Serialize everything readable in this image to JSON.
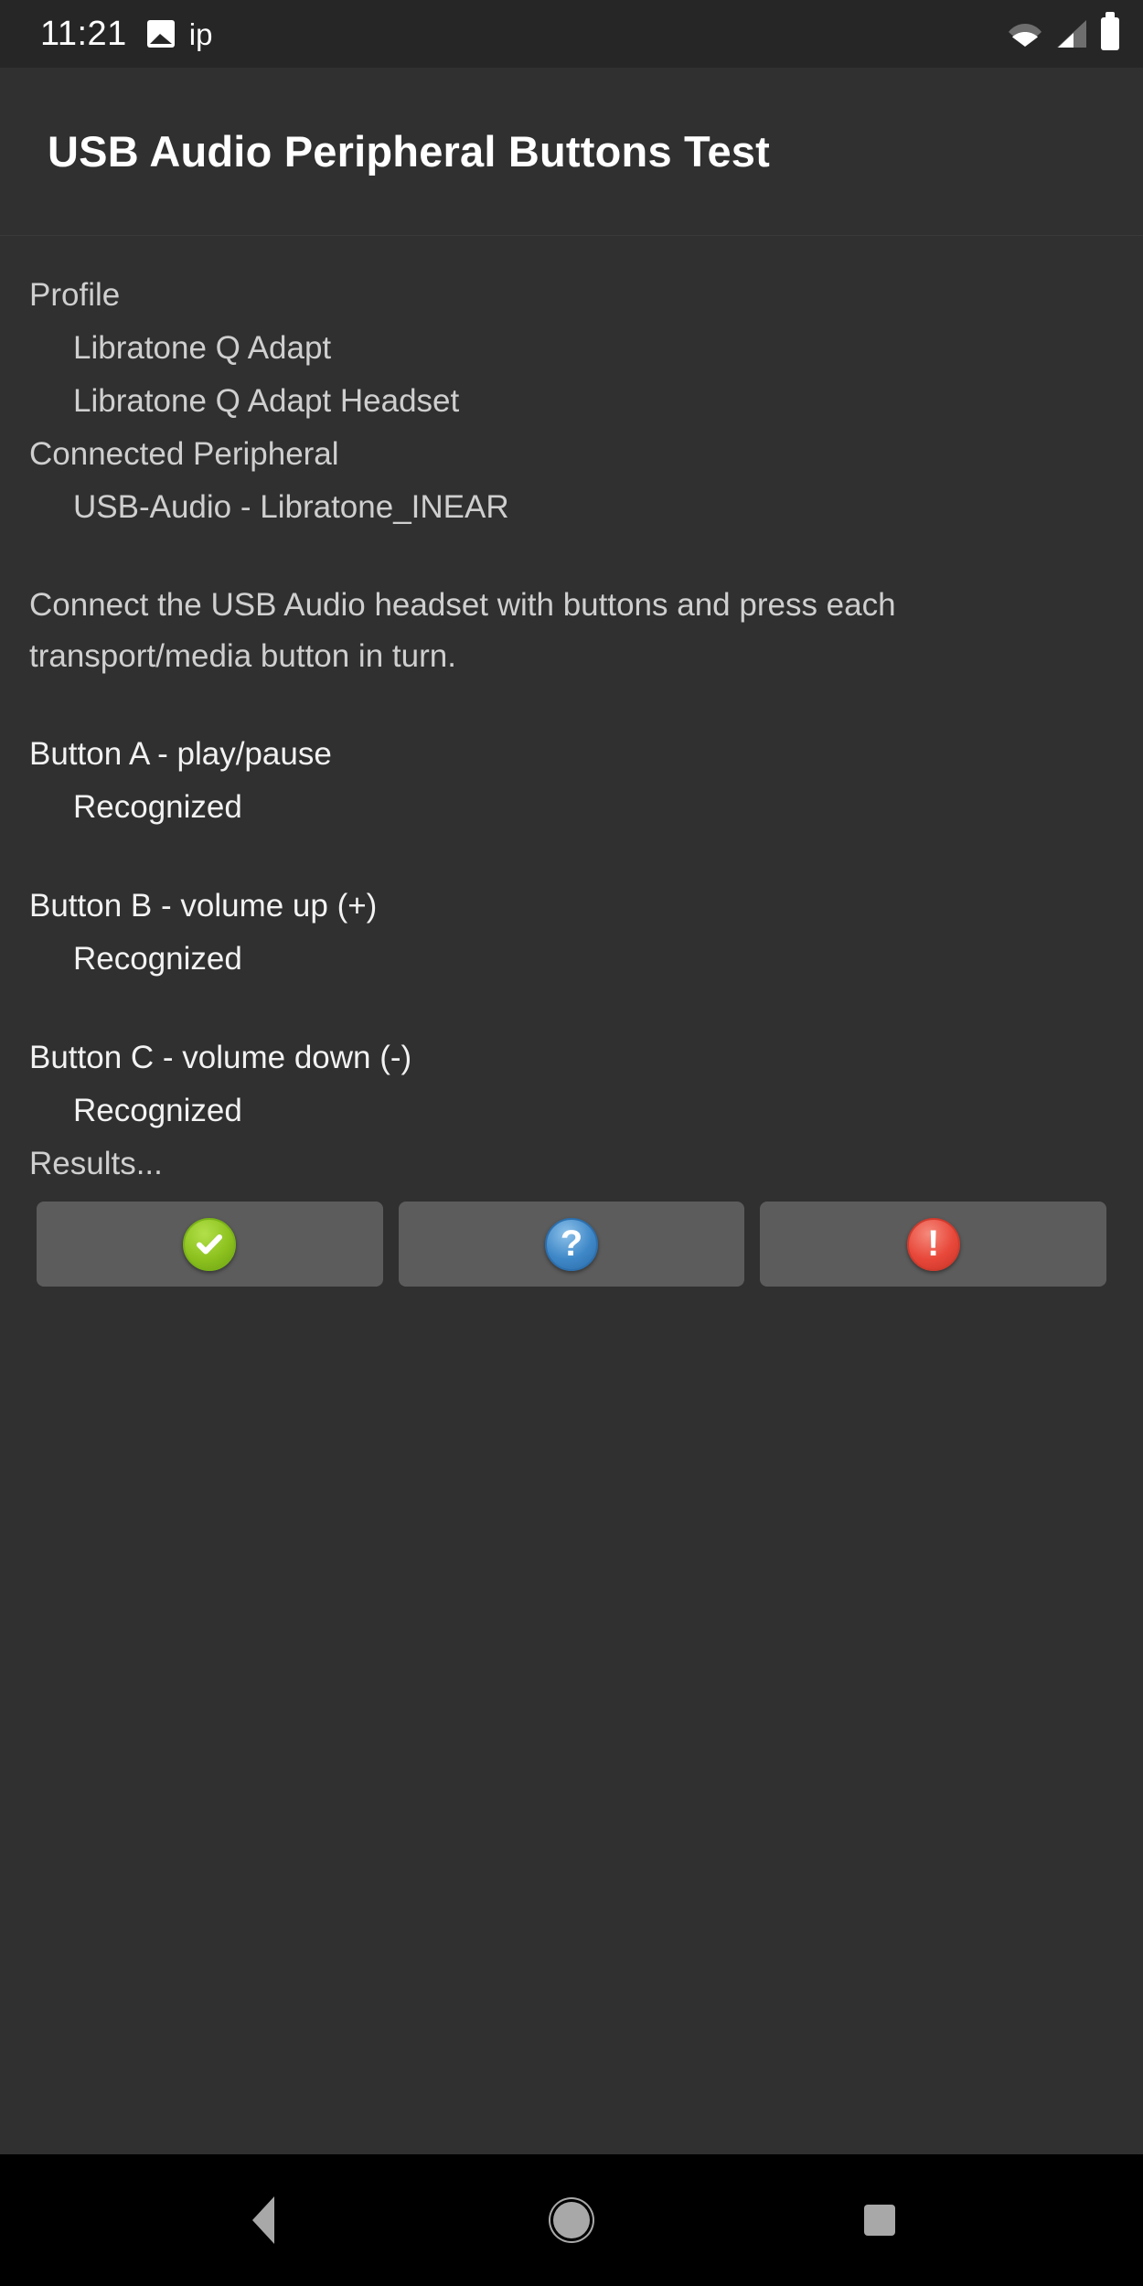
{
  "status_bar": {
    "clock": "11:21",
    "notification_label": "ip",
    "icons": [
      "photo-icon",
      "wifi-icon",
      "cell-signal-icon",
      "battery-icon"
    ]
  },
  "app": {
    "title": "USB Audio Peripheral Buttons Test"
  },
  "info": {
    "profile_heading": "Profile",
    "profile_name": "Libratone Q Adapt",
    "profile_product": "Libratone Q Adapt Headset",
    "connected_heading": "Connected Peripheral",
    "connected_device": "USB-Audio - Libratone_INEAR"
  },
  "instructions": {
    "text": "Connect the USB Audio headset with buttons and press each transport/media button in turn."
  },
  "tests": [
    {
      "label": "Button A - play/pause",
      "status": "Recognized"
    },
    {
      "label": "Button B - volume up (+)",
      "status": "Recognized"
    },
    {
      "label": "Button C - volume down (-)",
      "status": "Recognized"
    }
  ],
  "results": {
    "heading": "Results...",
    "buttons": [
      {
        "name": "pass-button",
        "icon": "check-circle-icon",
        "glyph": "✓",
        "color": "#8dc21f"
      },
      {
        "name": "info-button",
        "icon": "question-circle-icon",
        "glyph": "?",
        "color": "#3f88c8"
      },
      {
        "name": "fail-button",
        "icon": "exclamation-circle-icon",
        "glyph": "!",
        "color": "#e8483a"
      }
    ]
  },
  "nav_bar": {
    "back_label": "Back",
    "home_label": "Home",
    "recents_label": "Recents"
  }
}
